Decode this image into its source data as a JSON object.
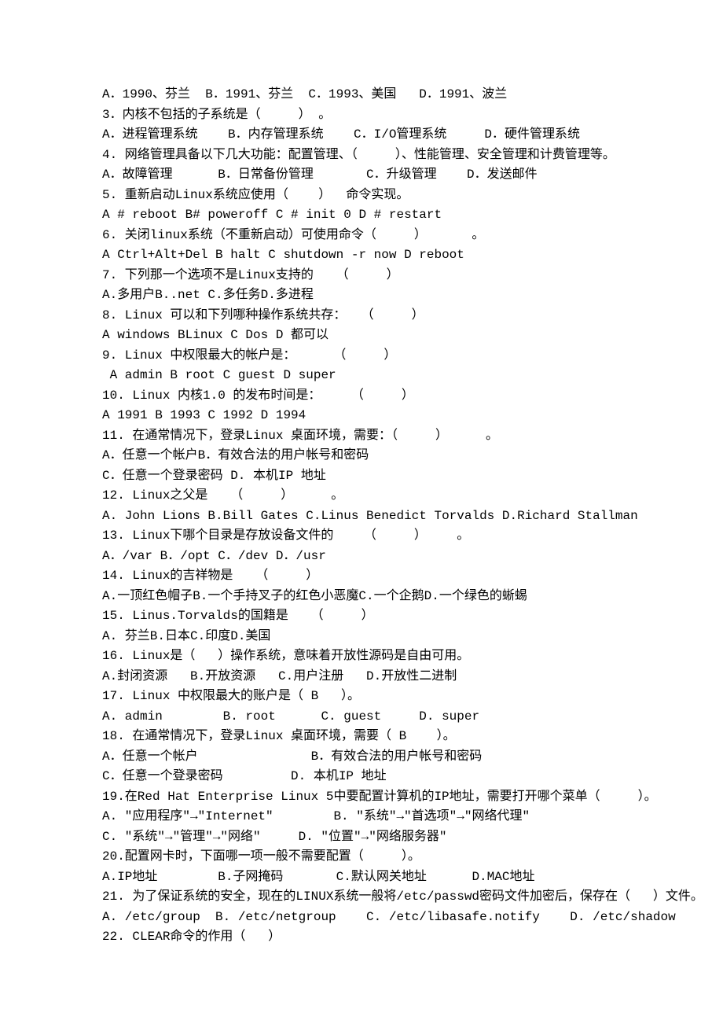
{
  "lines": [
    "A．1990、芬兰  B．1991、芬兰  C．1993、美国   D．1991、波兰",
    "3．内核不包括的子系统是（     ） 。",
    "A．进程管理系统    B．内存管理系统    C．I/O管理系统     D．硬件管理系统",
    "4. 网络管理具备以下几大功能：配置管理、（     ）、性能管理、安全管理和计费管理等。",
    "A．故障管理      B．日常备份管理       C．升级管理    D．发送邮件",
    "5. 重新启动Linux系统应使用（    ）  命令实现。",
    "A # reboot B# poweroff C # init 0 D # restart",
    "6. 关闭linux系统（不重新启动）可使用命令（     ）      。",
    "A Ctrl+Alt+Del B halt C shutdown -r now D reboot",
    "7. 下列那一个选项不是Linux支持的   （     ）",
    "A.多用户B..net C.多任务D.多进程",
    "8. Linux 可以和下列哪种操作系统共存：  （     ）",
    "A windows BLinux C Dos D 都可以",
    "9. Linux 中权限最大的帐户是：     （     ）",
    " A admin B root C guest D super",
    "10. Linux 内核1.0 的发布时间是：    （     ）",
    "A 1991 B 1993 C 1992 D 1994",
    "11. 在通常情况下，登录Linux 桌面环境，需要：（     ）     。",
    "A．任意一个帐户B．有效合法的用户帐号和密码",
    "C．任意一个登录密码 D. 本机IP 地址",
    "12. Linux之父是   （     ）     。",
    "A. John Lions B.Bill Gates C.Linus Benedict Torvalds D.Richard Stallman",
    "13. Linux下哪个目录是存放设备文件的    （     ）    。",
    "A．/var B．/opt C．/dev D．/usr",
    "14. Linux的吉祥物是   （     ）",
    "A.一顶红色帽子B.一个手持叉子的红色小恶魔C.一个企鹅D.一个绿色的蜥蜴",
    "15. Linus.Torvalds的国籍是   （     ）",
    "A. 芬兰B.日本C.印度D.美国",
    "16. Linux是（   ）操作系统，意味着开放性源码是自由可用。",
    "A.封闭资源   B.开放资源   C.用户注册   D.开放性二进制",
    "17. Linux 中权限最大的账户是（ B   ）。",
    "A. admin        B. root      C. guest     D. super",
    "18. 在通常情况下，登录Linux 桌面环境，需要（ B    ）。",
    "A．任意一个帐户               B．有效合法的用户帐号和密码",
    "C．任意一个登录密码         D. 本机IP 地址",
    "19.在Red Hat Enterprise Linux 5中要配置计算机的IP地址，需要打开哪个菜单（     ）。",
    "A. \"应用程序\"→\"Internet\"        B. \"系统\"→\"首选项\"→\"网络代理\"",
    "C. \"系统\"→\"管理\"→\"网络\"     D. \"位置\"→\"网络服务器\"",
    "20.配置网卡时，下面哪一项一般不需要配置（     ）。",
    "A.IP地址        B.子网掩码       C.默认网关地址      D.MAC地址",
    "21. 为了保证系统的安全，现在的LINUX系统一般将/etc/passwd密码文件加密后，保存在（   ）文件。",
    "A. /etc/group  B. /etc/netgroup    C. /etc/libasafe.notify    D. /etc/shadow",
    "22. CLEAR命令的作用（   ）"
  ]
}
